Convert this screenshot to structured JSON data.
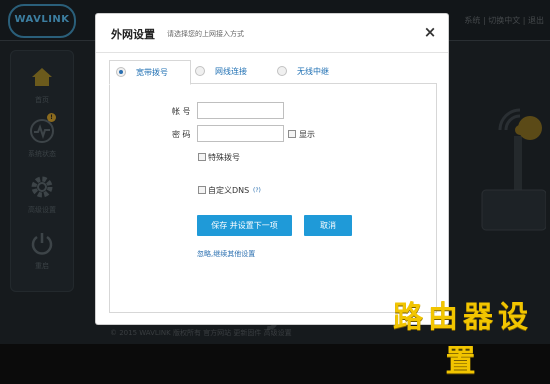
{
  "background": {
    "logo_text": "WAVLINK",
    "top_links": [
      "系统",
      "切换中文",
      "退出"
    ],
    "nav": [
      {
        "label": "首页",
        "icon": "home-icon"
      },
      {
        "label": "系统状态",
        "icon": "pulse-icon",
        "badge": "!"
      },
      {
        "label": "高级设置",
        "icon": "gear-icon"
      },
      {
        "label": "重启",
        "icon": "power-icon"
      }
    ],
    "footer": "© 2015 WAVLINK 版权所有   官方网站   更新固件   高级设置",
    "watermark": "MyDrivers"
  },
  "brand_logo": "路由器设置",
  "dialog": {
    "title": "外网设置",
    "subtitle": "请选择您的上网接入方式",
    "close_symbol": "×",
    "tabs": [
      {
        "label": "宽带拨号",
        "active": true
      },
      {
        "label": "网线连接",
        "active": false
      },
      {
        "label": "无线中继",
        "active": false
      }
    ],
    "form": {
      "account_label": "帐 号",
      "account_value": "",
      "password_label": "密 码",
      "password_value": "",
      "show_label": "显示",
      "special_dial_label": "特殊拨号",
      "custom_dns_label": "自定义DNS",
      "help_mark": "(?)"
    },
    "buttons": {
      "save_next": "保存 并设置下一项",
      "cancel": "取消"
    },
    "skip_link": "忽略,继续其他设置"
  },
  "colors": {
    "accent": "#1f9ad8",
    "link": "#2a6fb0",
    "brand_yellow": "#f2c500"
  }
}
